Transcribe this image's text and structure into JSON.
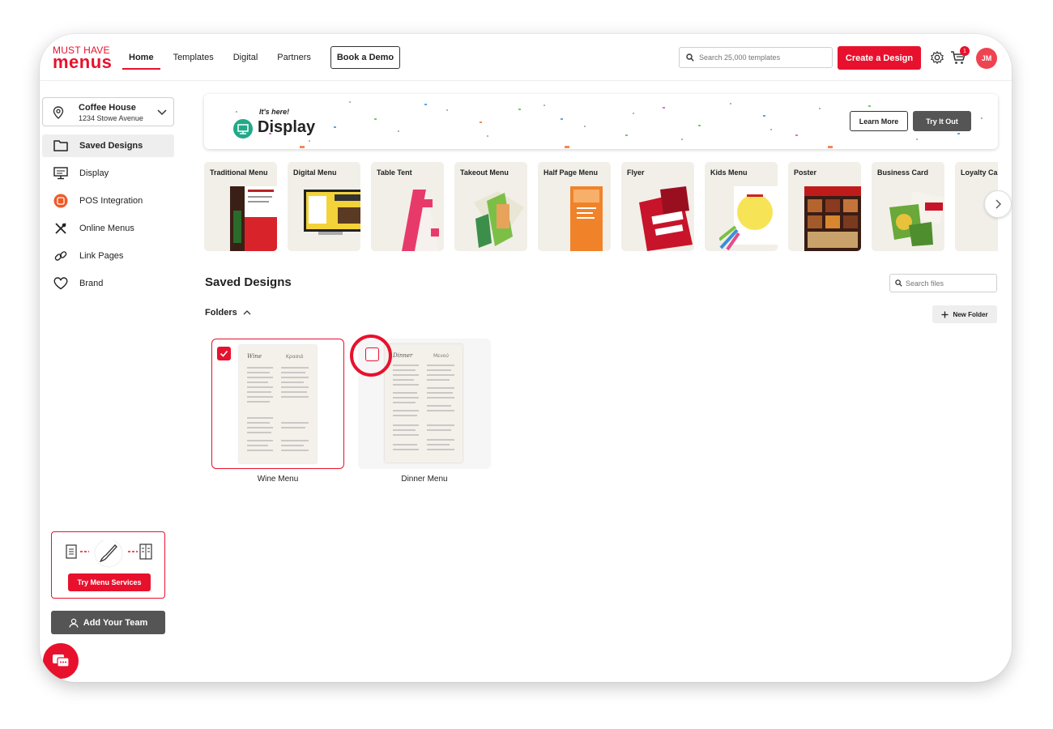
{
  "brand": {
    "logo_top": "MUST HAVE",
    "logo_bottom": "menus",
    "accent": "#e8112d"
  },
  "nav": {
    "items": [
      {
        "label": "Home",
        "active": true
      },
      {
        "label": "Templates",
        "active": false
      },
      {
        "label": "Digital",
        "active": false
      },
      {
        "label": "Partners",
        "active": false
      }
    ],
    "book_demo": "Book a Demo"
  },
  "header": {
    "search_placeholder": "Search 25,000 templates",
    "create_label": "Create a Design",
    "cart_count": "1",
    "avatar_initials": "JM",
    "icons": [
      "search-icon",
      "gear-icon",
      "cart-icon"
    ]
  },
  "location": {
    "name": "Coffee House",
    "address": "1234 Stowe Avenue"
  },
  "sidebar": {
    "items": [
      {
        "label": "Saved Designs",
        "icon": "folder-icon",
        "active": true
      },
      {
        "label": "Display",
        "icon": "monitor-icon",
        "active": false
      },
      {
        "label": "POS Integration",
        "icon": "pos-icon",
        "active": false
      },
      {
        "label": "Online Menus",
        "icon": "utensils-icon",
        "active": false
      },
      {
        "label": "Link Pages",
        "icon": "link-icon",
        "active": false
      },
      {
        "label": "Brand",
        "icon": "heart-icon",
        "active": false
      }
    ],
    "menu_services_label": "Try Menu Services",
    "add_team_label": "Add Your Team"
  },
  "banner": {
    "tagline": "It's here!",
    "title": "Display",
    "learn_more": "Learn More",
    "try_it": "Try It Out"
  },
  "templates": [
    {
      "label": "Traditional Menu"
    },
    {
      "label": "Digital Menu"
    },
    {
      "label": "Table Tent"
    },
    {
      "label": "Takeout Menu"
    },
    {
      "label": "Half Page Menu"
    },
    {
      "label": "Flyer"
    },
    {
      "label": "Kids Menu"
    },
    {
      "label": "Poster"
    },
    {
      "label": "Business Card"
    },
    {
      "label": "Loyalty Ca"
    }
  ],
  "saved": {
    "title": "Saved Designs",
    "search_placeholder": "Search files",
    "folders_label": "Folders",
    "new_folder": "New Folder",
    "designs": [
      {
        "name": "Wine Menu",
        "selected": true
      },
      {
        "name": "Dinner Menu",
        "selected": false
      }
    ]
  }
}
